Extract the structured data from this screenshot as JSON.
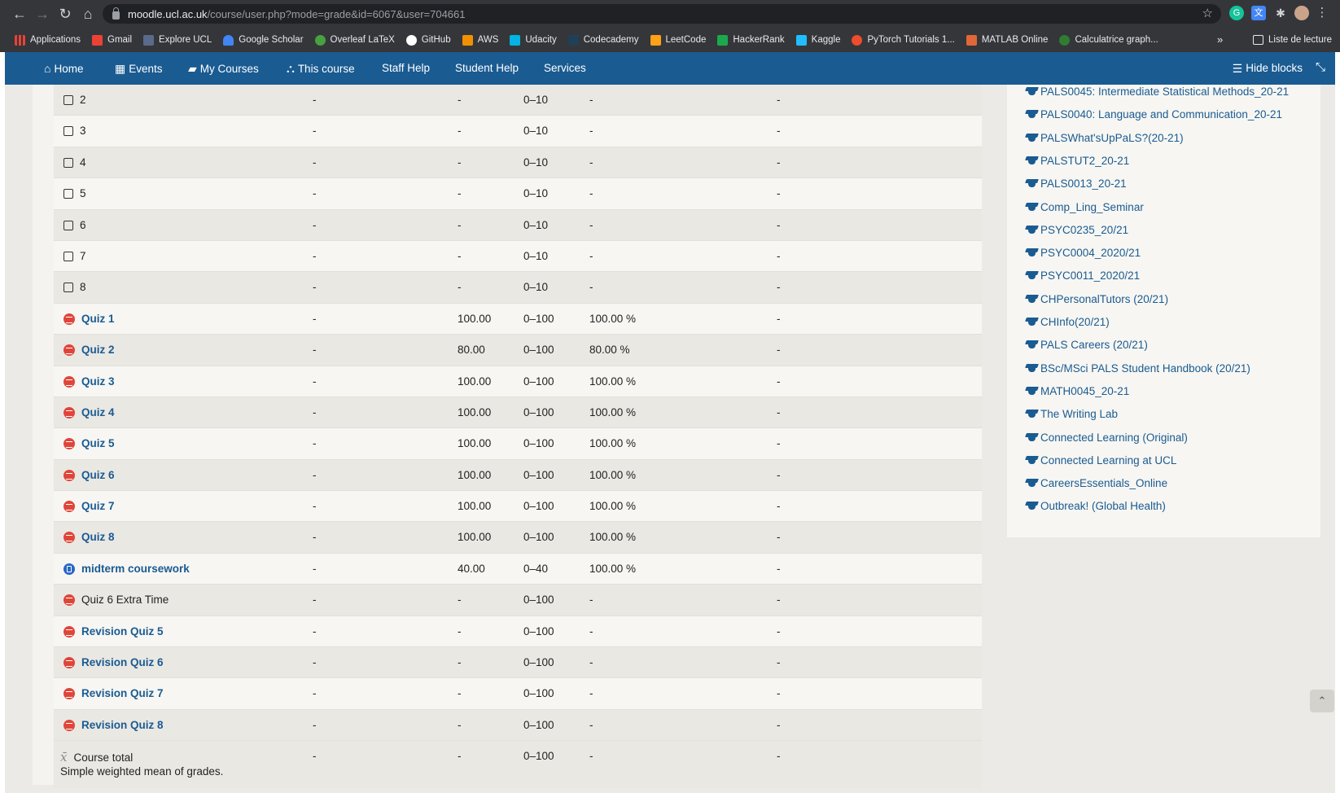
{
  "browser": {
    "url_host": "moodle.ucl.ac.uk",
    "url_path": "/course/user.php?mode=grade&id=6067&user=704661",
    "bookmarks": [
      {
        "label": "Applications",
        "color": "#4285f4"
      },
      {
        "label": "Gmail",
        "color": "#ea4335"
      },
      {
        "label": "Explore UCL",
        "color": "#5a6a8a"
      },
      {
        "label": "Google Scholar",
        "color": "#4285f4"
      },
      {
        "label": "Overleaf LaTeX",
        "color": "#47a141"
      },
      {
        "label": "GitHub",
        "color": "#ffffff"
      },
      {
        "label": "AWS",
        "color": "#f29100"
      },
      {
        "label": "Udacity",
        "color": "#02b3e4"
      },
      {
        "label": "Codecademy",
        "color": "#1f4056"
      },
      {
        "label": "LeetCode",
        "color": "#ffa116"
      },
      {
        "label": "HackerRank",
        "color": "#1ba94c"
      },
      {
        "label": "Kaggle",
        "color": "#20beff"
      },
      {
        "label": "PyTorch Tutorials 1...",
        "color": "#ee4c2c"
      },
      {
        "label": "MATLAB Online",
        "color": "#e16737"
      },
      {
        "label": "Calculatrice graph...",
        "color": "#2f7d32"
      }
    ],
    "bookmarks_overflow": "»",
    "reading_list": "Liste de lecture"
  },
  "nav": {
    "home": "Home",
    "events": "Events",
    "my_courses": "My Courses",
    "this_course": "This course",
    "staff_help": "Staff Help",
    "student_help": "Student Help",
    "services": "Services",
    "hide_blocks": "Hide blocks"
  },
  "grades": {
    "rows": [
      {
        "name": "2",
        "type": "checkbox",
        "weight": "-",
        "grade": "-",
        "range": "0–10",
        "percent": "-",
        "feedback": "-"
      },
      {
        "name": "3",
        "type": "checkbox",
        "weight": "-",
        "grade": "-",
        "range": "0–10",
        "percent": "-",
        "feedback": "-"
      },
      {
        "name": "4",
        "type": "checkbox",
        "weight": "-",
        "grade": "-",
        "range": "0–10",
        "percent": "-",
        "feedback": "-"
      },
      {
        "name": "5",
        "type": "checkbox",
        "weight": "-",
        "grade": "-",
        "range": "0–10",
        "percent": "-",
        "feedback": "-"
      },
      {
        "name": "6",
        "type": "checkbox",
        "weight": "-",
        "grade": "-",
        "range": "0–10",
        "percent": "-",
        "feedback": "-"
      },
      {
        "name": "7",
        "type": "checkbox",
        "weight": "-",
        "grade": "-",
        "range": "0–10",
        "percent": "-",
        "feedback": "-"
      },
      {
        "name": "8",
        "type": "checkbox",
        "weight": "-",
        "grade": "-",
        "range": "0–10",
        "percent": "-",
        "feedback": "-"
      },
      {
        "name": "Quiz 1",
        "type": "quiz",
        "weight": "-",
        "grade": "100.00",
        "range": "0–100",
        "percent": "100.00 %",
        "feedback": "-"
      },
      {
        "name": "Quiz 2",
        "type": "quiz",
        "weight": "-",
        "grade": "80.00",
        "range": "0–100",
        "percent": "80.00 %",
        "feedback": "-"
      },
      {
        "name": "Quiz 3",
        "type": "quiz",
        "weight": "-",
        "grade": "100.00",
        "range": "0–100",
        "percent": "100.00 %",
        "feedback": "-"
      },
      {
        "name": "Quiz 4",
        "type": "quiz",
        "weight": "-",
        "grade": "100.00",
        "range": "0–100",
        "percent": "100.00 %",
        "feedback": "-"
      },
      {
        "name": "Quiz 5",
        "type": "quiz",
        "weight": "-",
        "grade": "100.00",
        "range": "0–100",
        "percent": "100.00 %",
        "feedback": "-"
      },
      {
        "name": "Quiz 6",
        "type": "quiz",
        "weight": "-",
        "grade": "100.00",
        "range": "0–100",
        "percent": "100.00 %",
        "feedback": "-"
      },
      {
        "name": "Quiz 7",
        "type": "quiz",
        "weight": "-",
        "grade": "100.00",
        "range": "0–100",
        "percent": "100.00 %",
        "feedback": "-"
      },
      {
        "name": "Quiz 8",
        "type": "quiz",
        "weight": "-",
        "grade": "100.00",
        "range": "0–100",
        "percent": "100.00 %",
        "feedback": "-"
      },
      {
        "name": "midterm coursework",
        "type": "assign",
        "weight": "-",
        "grade": "40.00",
        "range": "0–40",
        "percent": "100.00 %",
        "feedback": "-"
      },
      {
        "name": "Quiz 6 Extra Time",
        "type": "quiz-plain",
        "weight": "-",
        "grade": "-",
        "range": "0–100",
        "percent": "-",
        "feedback": "-"
      },
      {
        "name": "Revision Quiz 5",
        "type": "quiz",
        "weight": "-",
        "grade": "-",
        "range": "0–100",
        "percent": "-",
        "feedback": "-"
      },
      {
        "name": "Revision Quiz 6",
        "type": "quiz",
        "weight": "-",
        "grade": "-",
        "range": "0–100",
        "percent": "-",
        "feedback": "-"
      },
      {
        "name": "Revision Quiz 7",
        "type": "quiz",
        "weight": "-",
        "grade": "-",
        "range": "0–100",
        "percent": "-",
        "feedback": "-"
      },
      {
        "name": "Revision Quiz 8",
        "type": "quiz",
        "weight": "-",
        "grade": "-",
        "range": "0–100",
        "percent": "-",
        "feedback": "-"
      }
    ],
    "total": {
      "name": "Course total",
      "subtitle": "Simple weighted mean of grades.",
      "weight": "-",
      "grade": "-",
      "range": "0–100",
      "percent": "-",
      "feedback": "-"
    }
  },
  "courses": [
    "PALS0045: Intermediate Statistical Methods_20-21",
    "PALS0040: Language and Communication_20-21",
    "PALSWhat'sUpPaLS?(20-21)",
    "PALSTUT2_20-21",
    "PALS0013_20-21",
    "Comp_Ling_Seminar",
    "PSYC0235_20/21",
    "PSYC0004_2020/21",
    "PSYC0011_2020/21",
    "CHPersonalTutors (20/21)",
    "CHInfo(20/21)",
    "PALS Careers (20/21)",
    "BSc/MSci PALS Student Handbook (20/21)",
    "MATH0045_20-21",
    "The Writing Lab",
    "Connected Learning (Original)",
    "Connected Learning at UCL",
    "CareersEssentials_Online",
    "Outbreak! (Global Health)"
  ],
  "icons": {
    "quiz": "quiz-icon",
    "assignment": "assignment-icon",
    "course": "graduation-cap-icon",
    "total": "mean-icon"
  },
  "colors": {
    "nav_bg": "#1a5b92",
    "link": "#1a5b92",
    "quiz_icon": "#e0453a",
    "assign_icon": "#2966c7"
  }
}
